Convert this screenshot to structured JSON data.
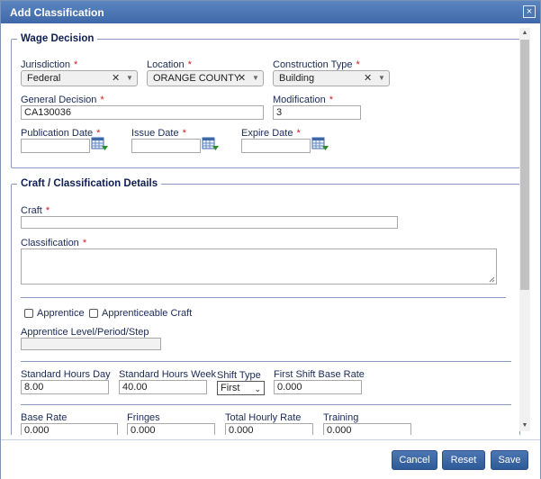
{
  "dialog": {
    "title": "Add Classification",
    "close_glyph": "×"
  },
  "wage_decision": {
    "legend": "Wage Decision",
    "jurisdiction": {
      "label": "Jurisdiction",
      "value": "Federal"
    },
    "location": {
      "label": "Location",
      "value": "ORANGE COUNTY"
    },
    "construction_type": {
      "label": "Construction Type",
      "value": "Building"
    },
    "general_decision": {
      "label": "General Decision",
      "value": "CA130036"
    },
    "modification": {
      "label": "Modification",
      "value": "3"
    },
    "publication_date": {
      "label": "Publication Date",
      "value": ""
    },
    "issue_date": {
      "label": "Issue Date",
      "value": ""
    },
    "expire_date": {
      "label": "Expire Date",
      "value": ""
    }
  },
  "craft_details": {
    "legend": "Craft / Classification Details",
    "craft": {
      "label": "Craft",
      "value": ""
    },
    "classification": {
      "label": "Classification",
      "value": ""
    },
    "apprentice": {
      "label": "Apprentice"
    },
    "apprenticeable_craft": {
      "label": "Apprenticeable Craft"
    },
    "apprentice_level": {
      "label": "Apprentice Level/Period/Step",
      "value": ""
    },
    "standard_hours_day": {
      "label": "Standard Hours Day",
      "value": "8.00"
    },
    "standard_hours_week": {
      "label": "Standard Hours Week",
      "value": "40.00"
    },
    "shift_type": {
      "label": "Shift Type",
      "value": "First"
    },
    "first_shift_base_rate": {
      "label": "First Shift Base Rate",
      "value": "0.000"
    },
    "base_rate": {
      "label": "Base Rate",
      "value": "0.000"
    },
    "fringes": {
      "label": "Fringes",
      "value": "0.000"
    },
    "total_hourly_rate": {
      "label": "Total Hourly Rate",
      "value": "0.000"
    },
    "training": {
      "label": "Training",
      "value": "0.000"
    }
  },
  "required_mark": "*",
  "footer": {
    "cancel": "Cancel",
    "reset": "Reset",
    "save": "Save"
  },
  "icons": {
    "calendar": "calendar-icon",
    "clear": "clear-x-icon",
    "dropdown": "chevron-down-icon"
  },
  "colors": {
    "titlebar": "#3e68a8",
    "button": "#2e5a98",
    "required": "#d21b1b",
    "label": "#1a2a57"
  }
}
